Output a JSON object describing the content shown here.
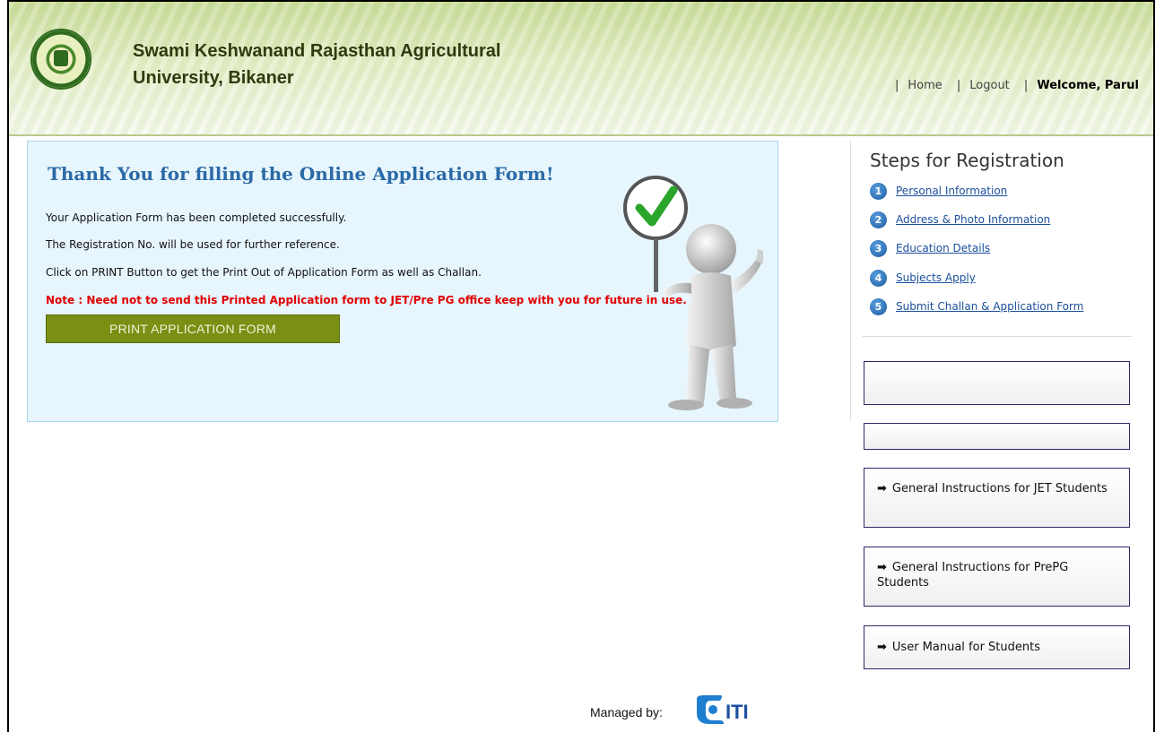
{
  "header": {
    "university_line1": "Swami Keshwanand Rajasthan Agricultural",
    "university_line2": "University, Bikaner",
    "nav": {
      "home": "Home",
      "logout": "Logout",
      "welcome": "Welcome, Parul"
    }
  },
  "main": {
    "title": "Thank You for filling the Online Application Form!",
    "lines": [
      "Your Application Form has been completed successfully.",
      "The Registration No. will be used for further reference.",
      "Click on PRINT Button to get the Print Out of Application Form as well as Challan."
    ],
    "note": "Note : Need not to send this Printed Application form to JET/Pre PG office keep with you for future in use.",
    "print_button": "PRINT APPLICATION FORM"
  },
  "sidebar": {
    "title": "Steps for Registration",
    "steps": [
      {
        "num": "1",
        "label": "Personal Information"
      },
      {
        "num": "2",
        "label": "Address & Photo Information"
      },
      {
        "num": "3",
        "label": "Education Details"
      },
      {
        "num": "4",
        "label": "Subjects Apply"
      },
      {
        "num": "5",
        "label": "Submit Challan & Application Form"
      }
    ],
    "links": [
      {
        "label": "General Instructions for JET Students"
      },
      {
        "label": "General Instructions for PrePG Students"
      },
      {
        "label": "User Manual for Students"
      }
    ]
  },
  "footer": {
    "managed_by": "Managed by:",
    "logo_text": "ITI"
  },
  "colors": {
    "accent": "#2b6aa6",
    "note": "#e00000",
    "button": "#7a8f14",
    "link": "#1a4f9c"
  }
}
